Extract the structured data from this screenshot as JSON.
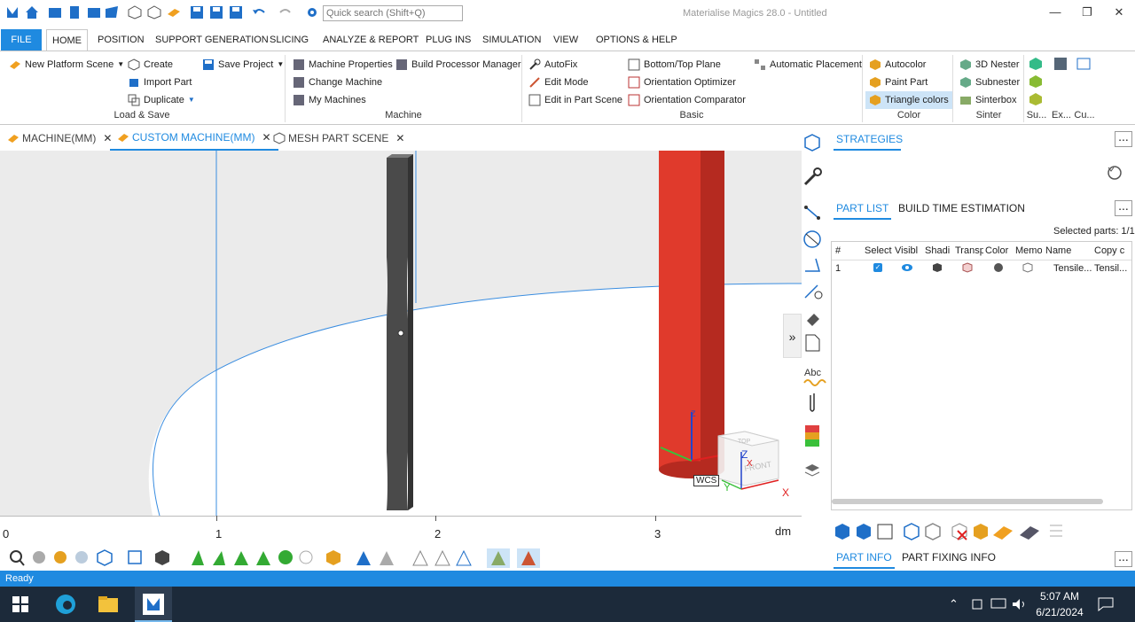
{
  "app": {
    "title": "Materialise Magics 28.0 - Untitled",
    "search_placeholder": "Quick search (Shift+Q)",
    "accent": "#1f8ae0"
  },
  "ribbon_tabs": [
    "FILE",
    "HOME",
    "POSITION",
    "SUPPORT GENERATION",
    "SLICING",
    "ANALYZE & REPORT",
    "PLUG INS",
    "SIMULATION",
    "VIEW",
    "OPTIONS & HELP"
  ],
  "ribbon": {
    "load_save": {
      "label": "Load & Save",
      "new_platform": "New Platform Scene",
      "create": "Create",
      "import_part": "Import Part",
      "duplicate": "Duplicate",
      "save_project": "Save Project"
    },
    "machine": {
      "label": "Machine",
      "machine_properties": "Machine Properties",
      "change_machine": "Change Machine",
      "my_machines": "My Machines",
      "build_processor": "Build Processor Manager"
    },
    "basic": {
      "label": "Basic",
      "autofix": "AutoFix",
      "edit_mode": "Edit Mode",
      "edit_in_part_scene": "Edit in Part Scene",
      "bottom_top_plane": "Bottom/Top Plane",
      "orientation_optimizer": "Orientation Optimizer",
      "orientation_comparator": "Orientation Comparator",
      "automatic_placement": "Automatic Placement"
    },
    "color": {
      "label": "Color",
      "autocolor": "Autocolor",
      "paint_part": "Paint Part",
      "triangle_colors": "Triangle colors"
    },
    "sinter": {
      "label": "Sinter",
      "nester": "3D Nester",
      "subnester": "Subnester",
      "sinterbox": "Sinterbox"
    },
    "more_groups": [
      "Su...",
      "Ex...",
      "Cu..."
    ]
  },
  "doc_tabs": [
    {
      "label": "MACHINE(MM)"
    },
    {
      "label": "CUSTOM MACHINE(MM)"
    },
    {
      "label": "MESH PART SCENE"
    }
  ],
  "viewport": {
    "ruler_ticks": [
      "0",
      "1",
      "2",
      "3"
    ],
    "ruler_unit": "dm",
    "wcs_label": "WCS",
    "cube_front": "FRONT",
    "cube_top": "TOP",
    "axis_x": "X",
    "axis_y": "Y",
    "axis_z": "Z"
  },
  "right_panel": {
    "strategies_tab": "STRATEGIES",
    "tabs": [
      "PART LIST",
      "BUILD TIME ESTIMATION"
    ],
    "selected_parts": "Selected parts:  1/1",
    "columns": [
      "#",
      "Select",
      "Visibl",
      "Shadi",
      "Transp",
      "Color",
      "Memo",
      "Name",
      "Copy c"
    ],
    "rows": [
      {
        "num": "1",
        "name": "Tensile...",
        "copy": "Tensil..."
      }
    ],
    "bottom_tabs": [
      "PART INFO",
      "PART FIXING INFO"
    ]
  },
  "status": "Ready",
  "taskbar": {
    "time": "5:07 AM",
    "date": "6/21/2024"
  }
}
